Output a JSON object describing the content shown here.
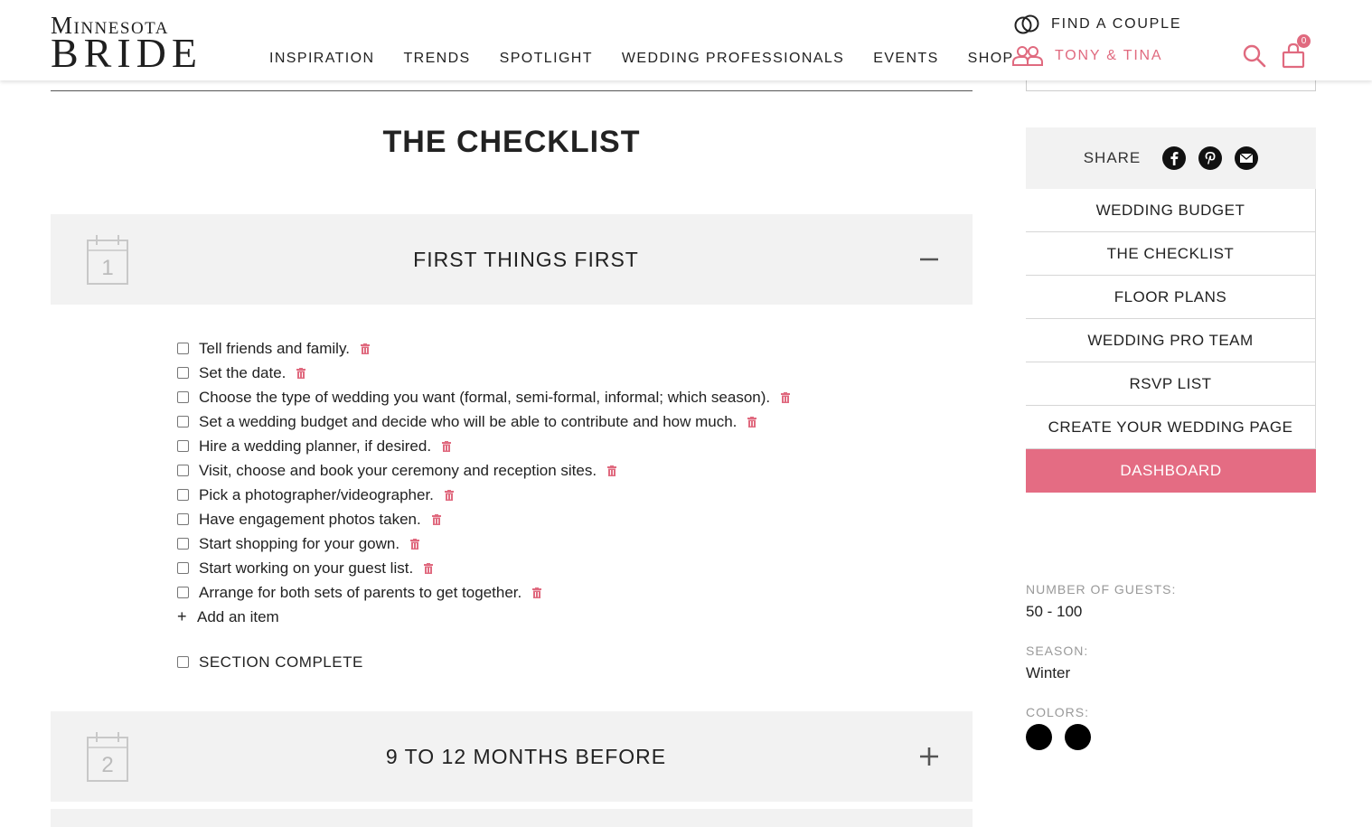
{
  "header": {
    "logo_top": "Minnesota",
    "logo_bottom": "BRIDE",
    "nav": [
      "INSPIRATION",
      "TRENDS",
      "SPOTLIGHT",
      "WEDDING PROFESSIONALS",
      "EVENTS",
      "SHOP"
    ],
    "find_couple_label": "FIND A COUPLE",
    "couple_name": "TONY & TINA",
    "cart_count": "0"
  },
  "main": {
    "page_title": "THE CHECKLIST",
    "sections": [
      {
        "number": "1",
        "title": "FIRST THINGS FIRST",
        "toggle": "collapse",
        "items": [
          "Tell friends and family.",
          "Set the date.",
          "Choose the type of wedding you want (formal, semi-formal, informal; which season).",
          "Set a wedding budget and decide who will be able to contribute and how much.",
          "Hire a wedding planner, if desired.",
          "Visit, choose and book your ceremony and reception sites.",
          "Pick a photographer/videographer.",
          "Have engagement photos taken.",
          "Start shopping for your gown.",
          "Start working on your guest list.",
          "Arrange for both sets of parents to get together."
        ],
        "add_item_label": "Add an item",
        "section_complete_label": "SECTION COMPLETE"
      },
      {
        "number": "2",
        "title": "9 TO 12 MONTHS BEFORE",
        "toggle": "expand"
      }
    ]
  },
  "sidebar": {
    "share_label": "SHARE",
    "share_icons": [
      "facebook-icon",
      "pinterest-icon",
      "email-icon"
    ],
    "menu": [
      "WEDDING BUDGET",
      "THE CHECKLIST",
      "FLOOR PLANS",
      "WEDDING PRO TEAM",
      "RSVP LIST",
      "CREATE YOUR WEDDING PAGE",
      "DASHBOARD"
    ],
    "active_menu": "DASHBOARD",
    "guests_label": "NUMBER OF GUESTS:",
    "guests_value": "50 - 100",
    "season_label": "SEASON:",
    "season_value": "Winter",
    "colors_label": "COLORS:",
    "colors": [
      "#000000",
      "#000000"
    ]
  },
  "theme": {
    "accent": "#e46c83",
    "panel_bg": "#f2f2f2"
  }
}
